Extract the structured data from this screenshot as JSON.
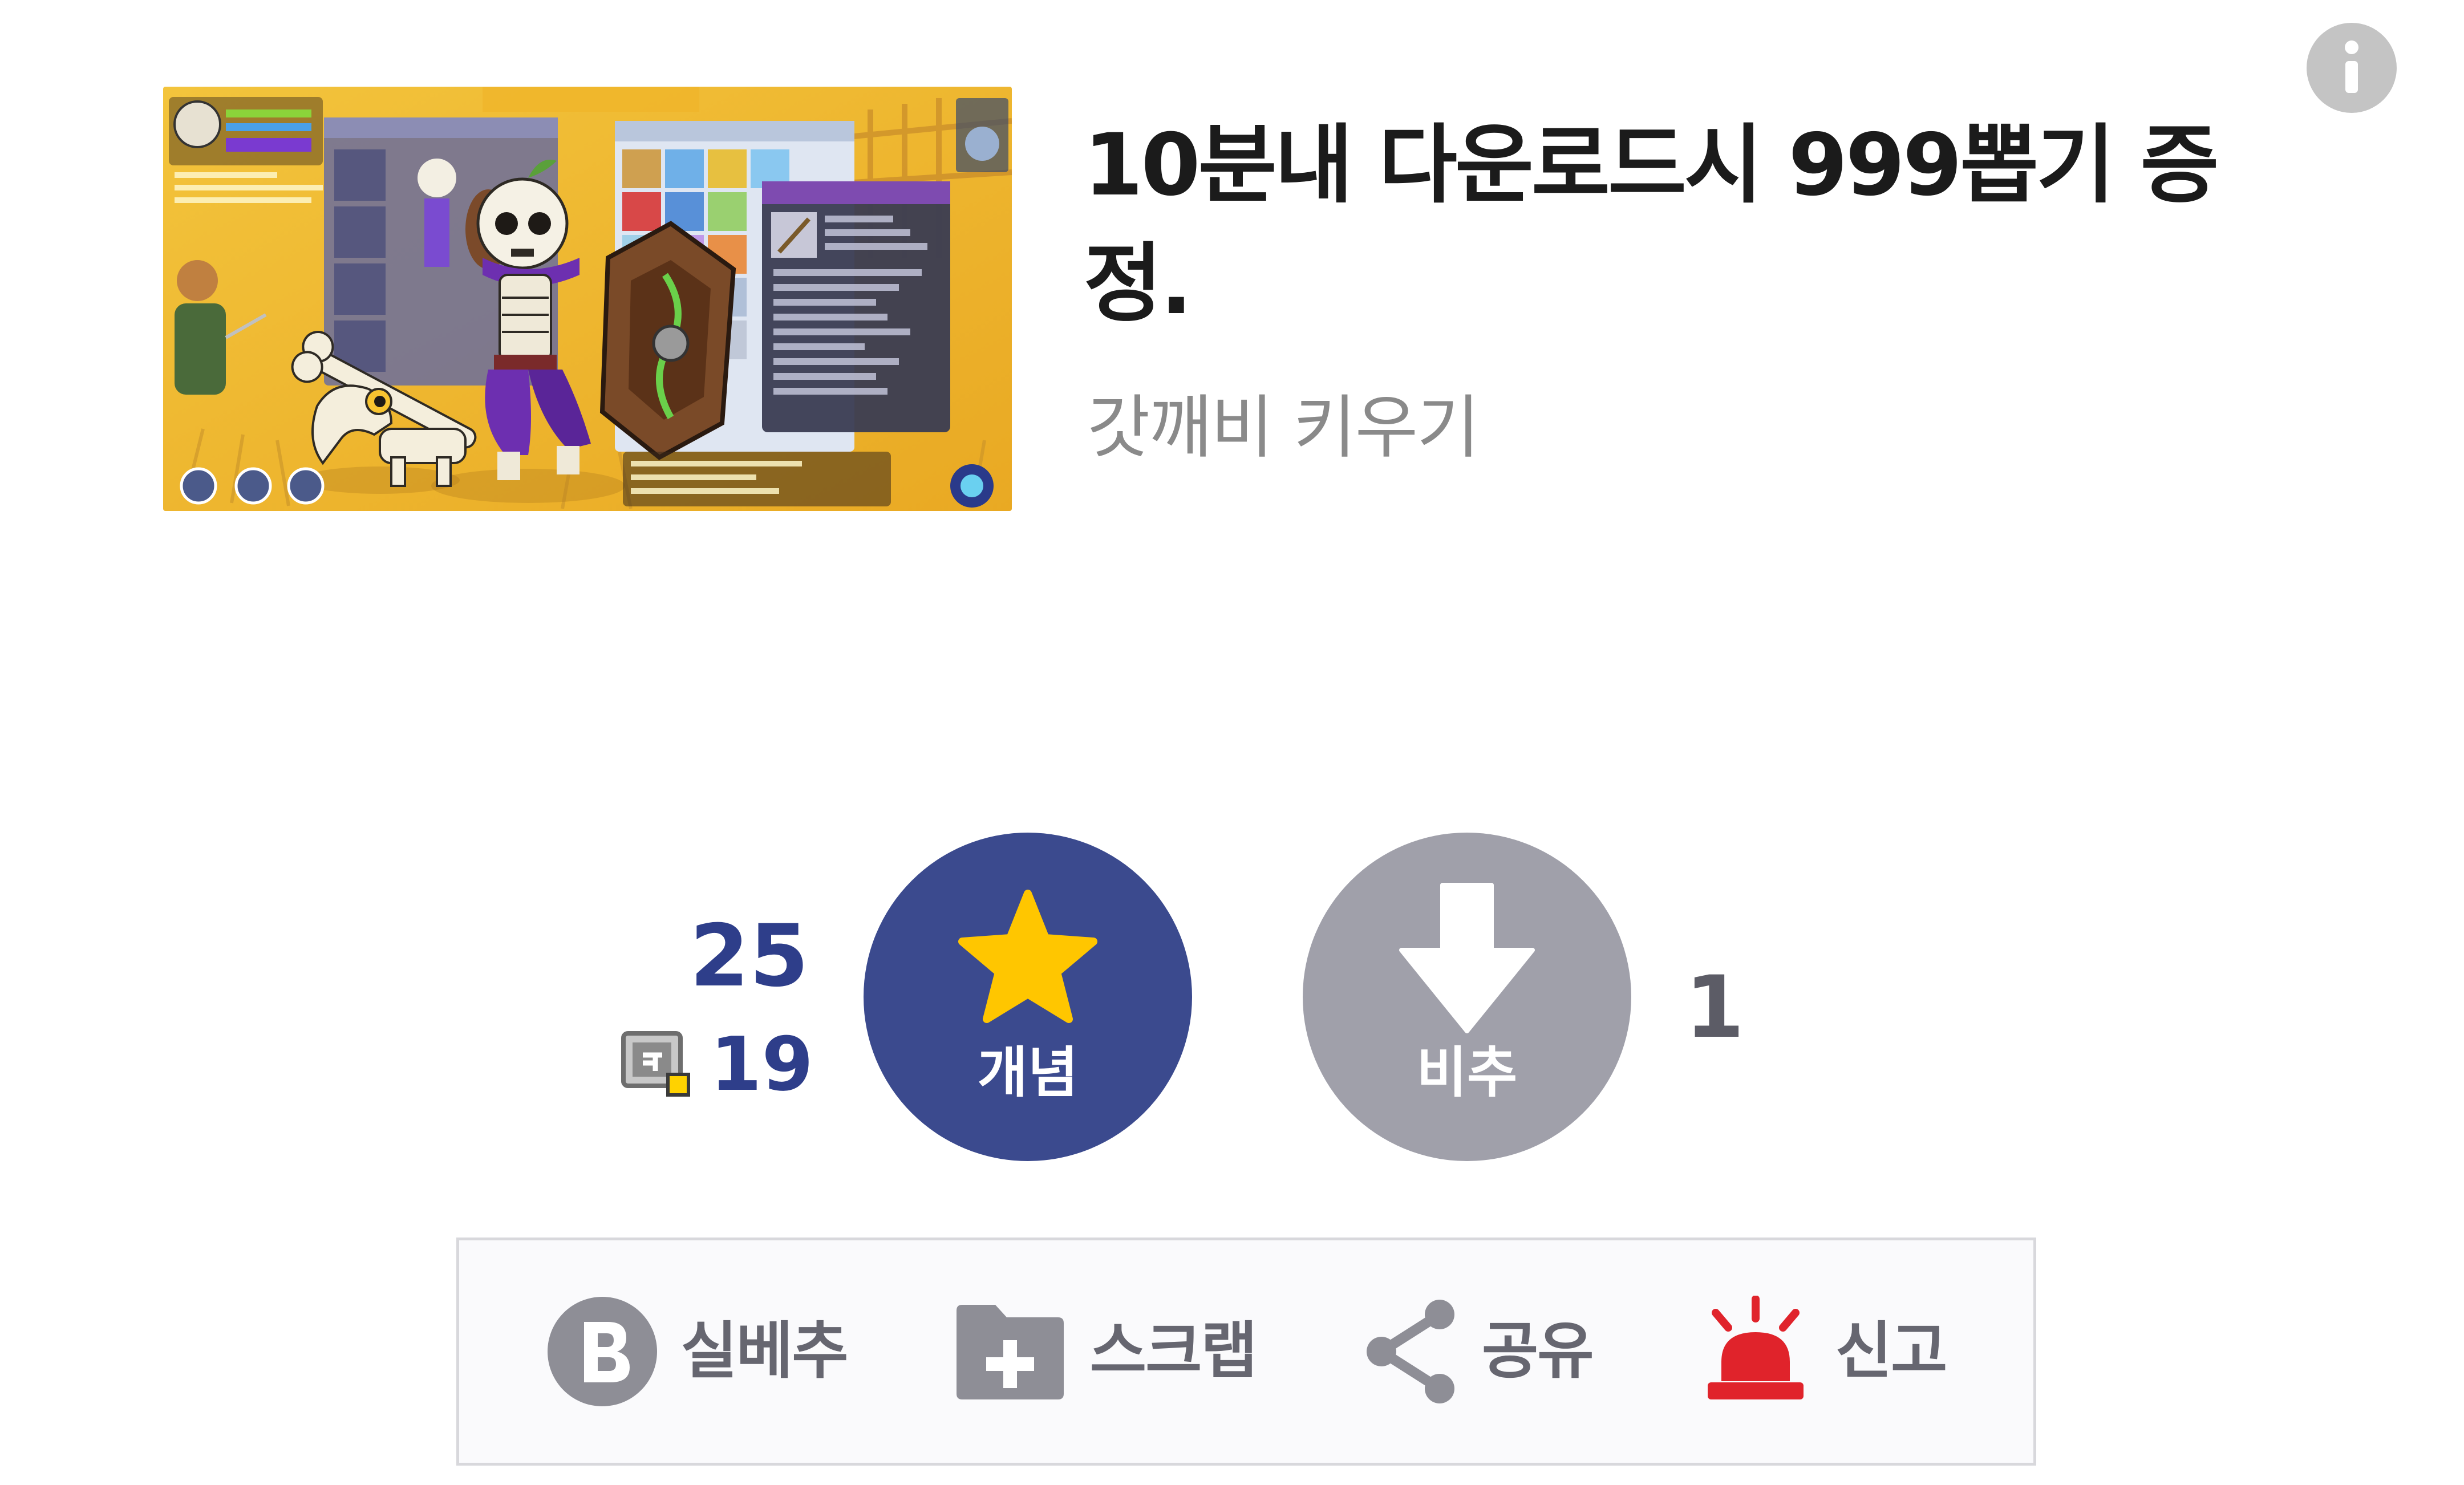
{
  "post": {
    "title": "10분내 다운로드시 999뽑기 증정.",
    "subtitle": "갓깨비 키우기",
    "thumbnail": {
      "alt": "갓깨비 키우기 game screenshot"
    },
    "info_icon": "info-icon"
  },
  "vote": {
    "up_count": "25",
    "fixed_count": "19",
    "fixed_icon": "fixed-nickname-icon",
    "up_label": "개념",
    "up_icon": "star-icon",
    "down_label": "비추",
    "down_icon": "arrow-down-icon",
    "down_count": "1",
    "colors": {
      "up": "#3b4a8e",
      "down": "#a0a0aa",
      "star": "#ffc600"
    }
  },
  "actions": [
    {
      "label": "실베추",
      "icon": "b-circle-icon"
    },
    {
      "label": "스크랩",
      "icon": "folder-plus-icon"
    },
    {
      "label": "공유",
      "icon": "share-icon"
    },
    {
      "label": "신고",
      "icon": "siren-icon",
      "color": "#e0232b"
    }
  ]
}
